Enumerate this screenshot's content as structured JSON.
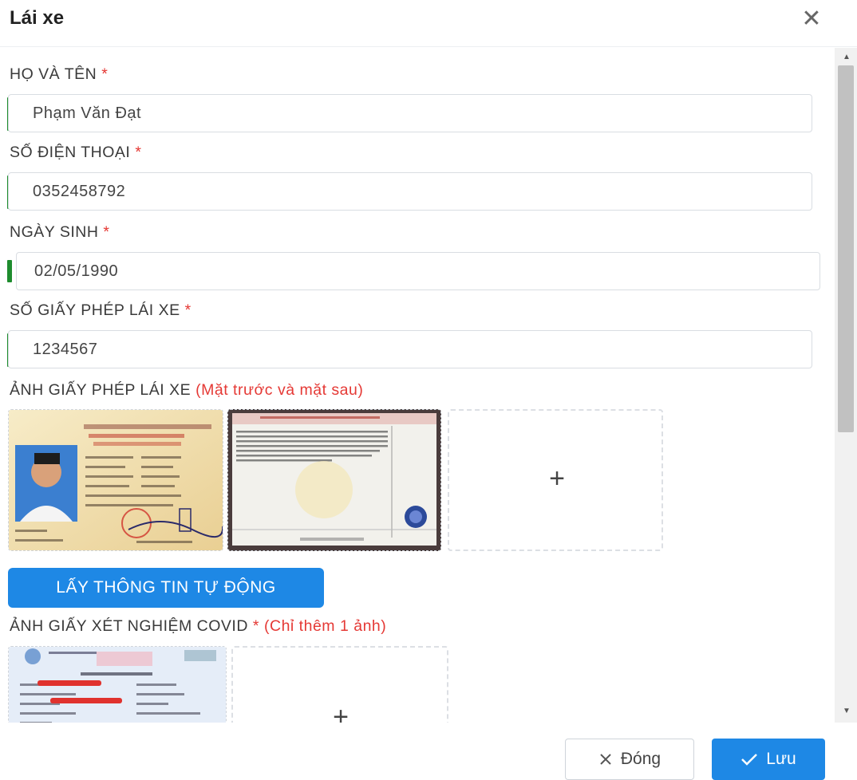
{
  "dialog": {
    "title": "Lái xe",
    "close_glyph": "✕"
  },
  "form": {
    "fullname": {
      "label": "HỌ VÀ TÊN",
      "required_mark": "*",
      "value": "Phạm Văn Đạt"
    },
    "phone": {
      "label": "SỐ ĐIỆN THOẠI",
      "required_mark": "*",
      "value": "0352458792"
    },
    "birthday": {
      "label": "NGÀY SINH",
      "required_mark": "*",
      "value": "02/05/1990"
    },
    "license_no": {
      "label": "SỐ GIẤY PHÉP LÁI XE",
      "required_mark": "*",
      "value": "1234567"
    }
  },
  "license_photos": {
    "label": "ẢNH GIẤY PHÉP LÁI XE",
    "note": "(Mặt trước và mặt sau)",
    "images": [
      "license-front-photo",
      "license-back-photo"
    ],
    "add_glyph": "+"
  },
  "auto_fill_button": "LẤY THÔNG TIN TỰ ĐỘNG",
  "covid_test": {
    "label": "ẢNH GIẤY XÉT NGHIỆM COVID",
    "required_mark": "*",
    "note": "(Chỉ thêm 1 ảnh)",
    "images": [
      "covid-test-photo"
    ],
    "add_glyph": "+"
  },
  "footer": {
    "close_label": "Đóng",
    "close_icon": "close-icon",
    "save_label": "Lưu",
    "save_icon": "check-icon"
  },
  "colors": {
    "primary": "#1e88e5",
    "required": "#e53935",
    "valid_indicator": "#1e8c2e"
  }
}
